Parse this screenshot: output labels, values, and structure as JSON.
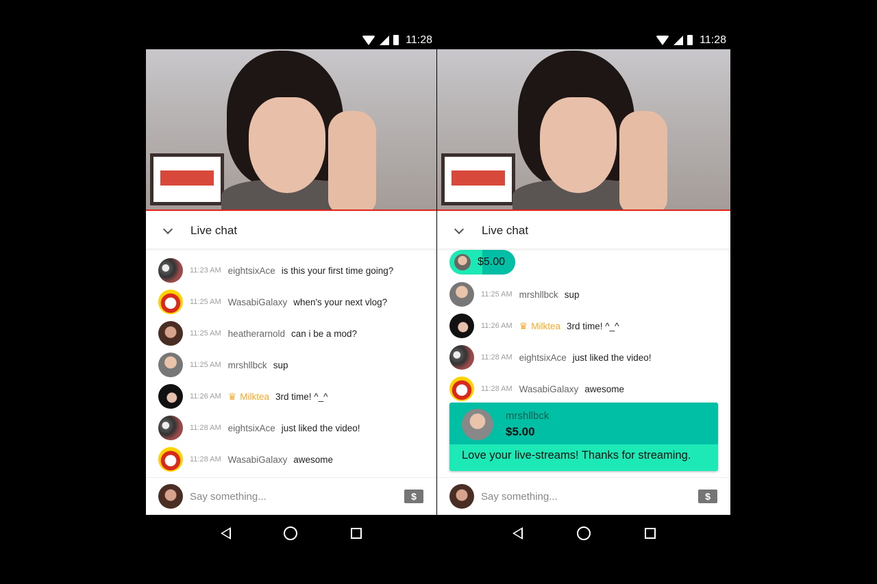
{
  "phones": [
    {
      "status": {
        "time": "11:28"
      },
      "header": {
        "title": "Live chat"
      },
      "ticker": null,
      "messages": [
        {
          "avatar": "ace",
          "time": "11:23 AM",
          "user": "eightsixAce",
          "text": "is this your first time going?"
        },
        {
          "avatar": "wasabi",
          "time": "11:25 AM",
          "user": "WasabiGalaxy",
          "text": "when's your next vlog?"
        },
        {
          "avatar": "heather",
          "time": "11:25 AM",
          "user": "heatherarnold",
          "text": "can i be a mod?"
        },
        {
          "avatar": "mrsh",
          "time": "11:25 AM",
          "user": "mrshllbck",
          "text": "sup"
        },
        {
          "avatar": "milk",
          "time": "11:26 AM",
          "user": "Milktea",
          "text": "3rd time! ^_^",
          "owner": true
        },
        {
          "avatar": "ace",
          "time": "11:28 AM",
          "user": "eightsixAce",
          "text": "just liked the video!"
        },
        {
          "avatar": "wasabi",
          "time": "11:28 AM",
          "user": "WasabiGalaxy",
          "text": "awesome"
        }
      ],
      "superchat": null,
      "input": {
        "placeholder": "Say something..."
      }
    },
    {
      "status": {
        "time": "11:28"
      },
      "header": {
        "title": "Live chat"
      },
      "ticker": {
        "amount": "$5.00",
        "progress": 0.5
      },
      "messages": [
        {
          "avatar": "mrsh",
          "time": "11:25 AM",
          "user": "mrshllbck",
          "text": "sup"
        },
        {
          "avatar": "milk",
          "time": "11:26 AM",
          "user": "Milktea",
          "text": "3rd time! ^_^",
          "owner": true
        },
        {
          "avatar": "ace",
          "time": "11:28 AM",
          "user": "eightsixAce",
          "text": "just liked the video!"
        },
        {
          "avatar": "wasabi",
          "time": "11:28 AM",
          "user": "WasabiGalaxy",
          "text": "awesome"
        }
      ],
      "superchat": {
        "user": "mrshllbck",
        "amount": "$5.00",
        "message": "Love your live-streams! Thanks for streaming."
      },
      "input": {
        "placeholder": "Say something..."
      }
    }
  ],
  "icons": {
    "dollar": "$",
    "crown": "♛"
  },
  "colors": {
    "accent_red": "#e62117",
    "superchat_dark": "#00bfa5",
    "superchat_light": "#1de9b6",
    "owner": "#f9a825"
  }
}
